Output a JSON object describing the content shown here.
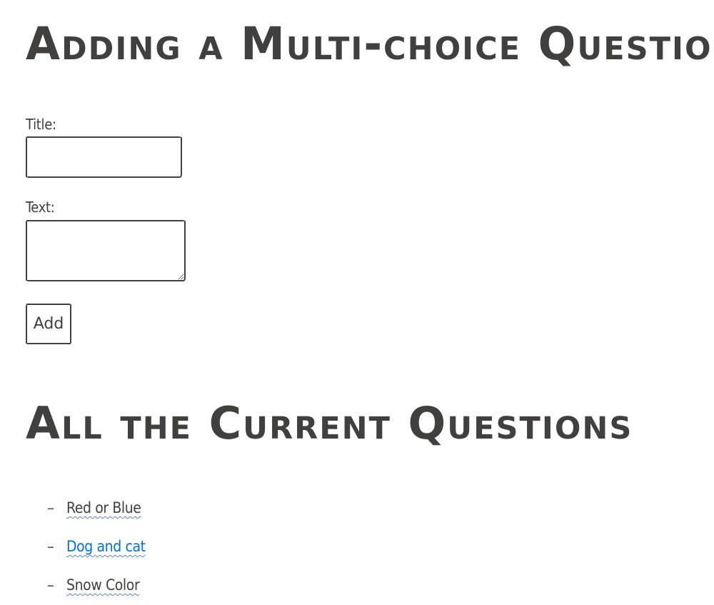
{
  "headings": {
    "add_question": "Adding a Multi-choice Question",
    "current_questions": "All the Current Questions"
  },
  "form": {
    "title_label": "Title:",
    "title_value": "",
    "text_label": "Text:",
    "text_value": "",
    "add_button_label": "Add"
  },
  "questions": [
    {
      "label": "Red or Blue",
      "active": false
    },
    {
      "label": "Dog and cat",
      "active": true
    },
    {
      "label": "Snow Color",
      "active": false
    }
  ],
  "colors": {
    "text": "#41403e",
    "link_active": "#0071de",
    "wavy_underline": "#5a84c0",
    "background": "#ffffff"
  }
}
